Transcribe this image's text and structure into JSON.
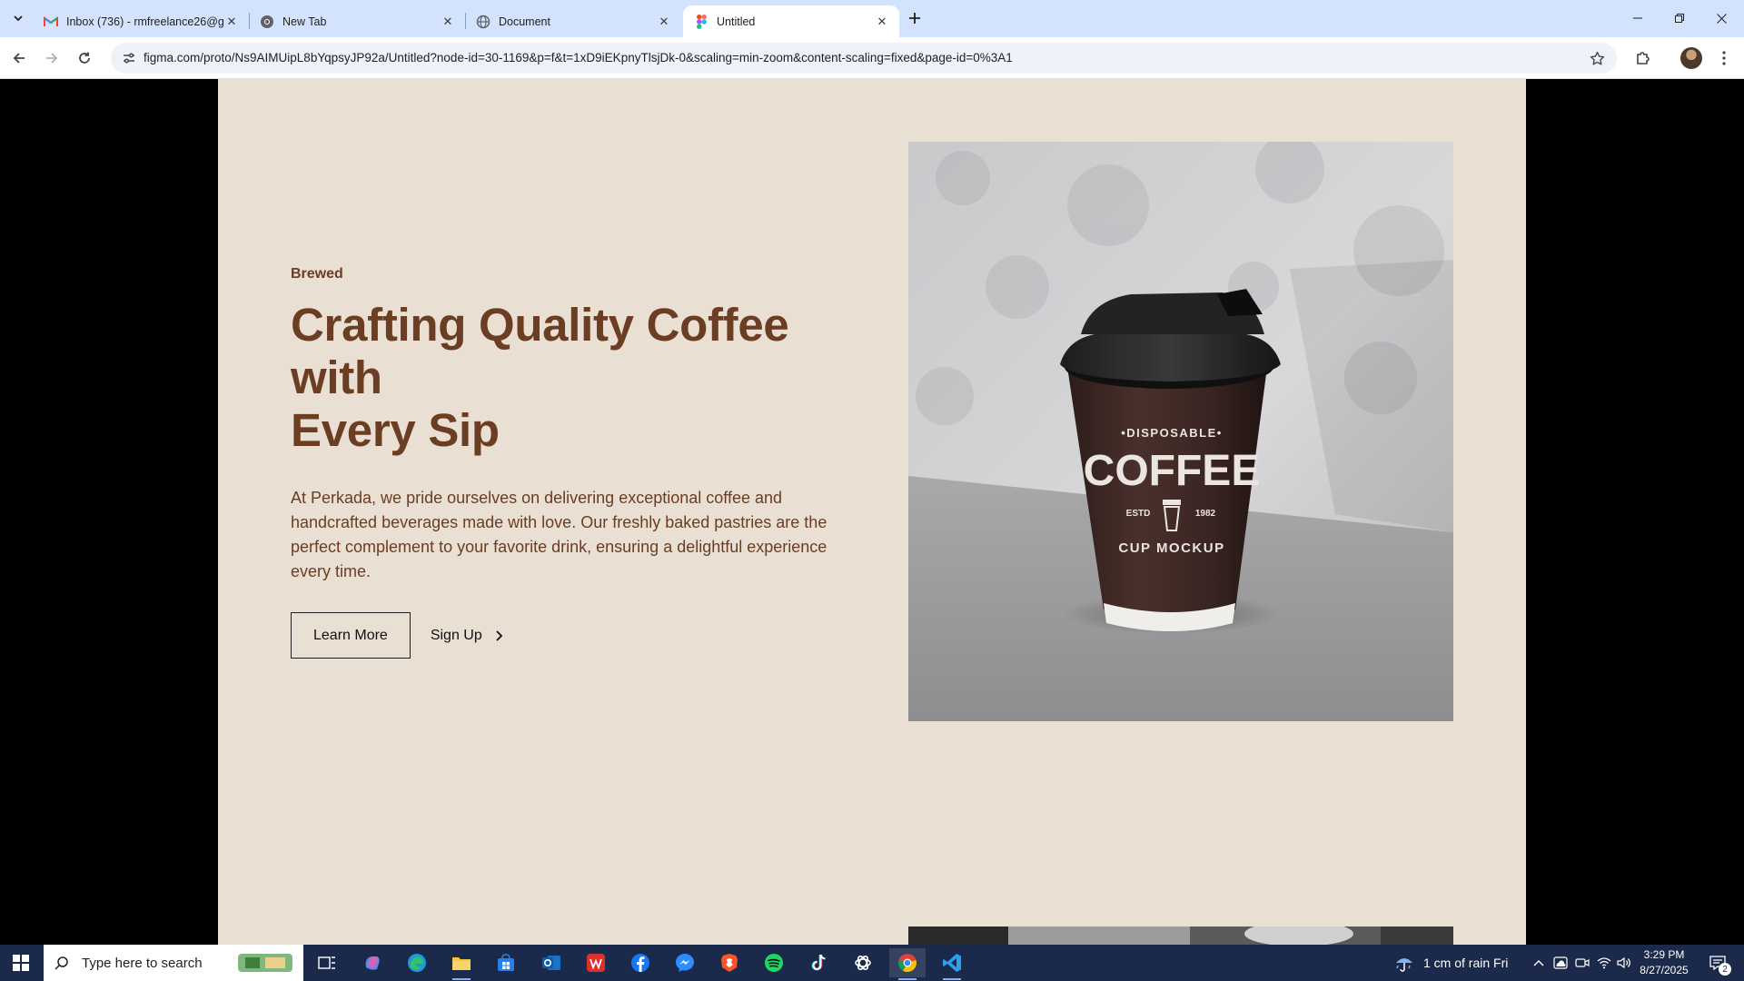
{
  "browser": {
    "tabs": [
      {
        "title": "Inbox (736) - rmfreelance26@g",
        "icon": "gmail-icon",
        "active": false
      },
      {
        "title": "New Tab",
        "icon": "chrome-icon",
        "active": false
      },
      {
        "title": "Document",
        "icon": "globe-icon",
        "active": false
      },
      {
        "title": "Untitled",
        "icon": "figma-icon",
        "active": true
      }
    ],
    "url": "figma.com/proto/Ns9AIMUipL8bYqpsyJP92a/Untitled?node-id=30-1169&p=f&t=1xD9iEKpnyTlsjDk-0&scaling=min-zoom&content-scaling=fixed&page-id=0%3A1"
  },
  "hero": {
    "tagline": "Brewed",
    "headline_line1": "Crafting Quality Coffee with",
    "headline_line2": "Every Sip",
    "body": "At Perkada, we pride ourselves on delivering exceptional coffee and handcrafted beverages made with love. Our freshly baked pastries are the perfect complement to your favorite drink, ensuring a delightful experience every time.",
    "primary_button": "Learn More",
    "secondary_button": "Sign Up",
    "image": {
      "cup_top_text": "•DISPOSABLE•",
      "cup_main_text": "COFFEE",
      "cup_estd_left": "ESTD",
      "cup_estd_right": "1982",
      "cup_bottom_text": "CUP MOCKUP"
    }
  },
  "colors": {
    "page_background": "#e9dfd3",
    "brand_brown": "#6b3d23",
    "tab_strip": "#d3e3fd",
    "taskbar": "#1b2a4a"
  },
  "taskbar": {
    "search_placeholder": "Type here to search",
    "weather": "1 cm of rain Fri",
    "time": "3:29 PM",
    "date": "8/27/2025",
    "notification_count": "2"
  }
}
